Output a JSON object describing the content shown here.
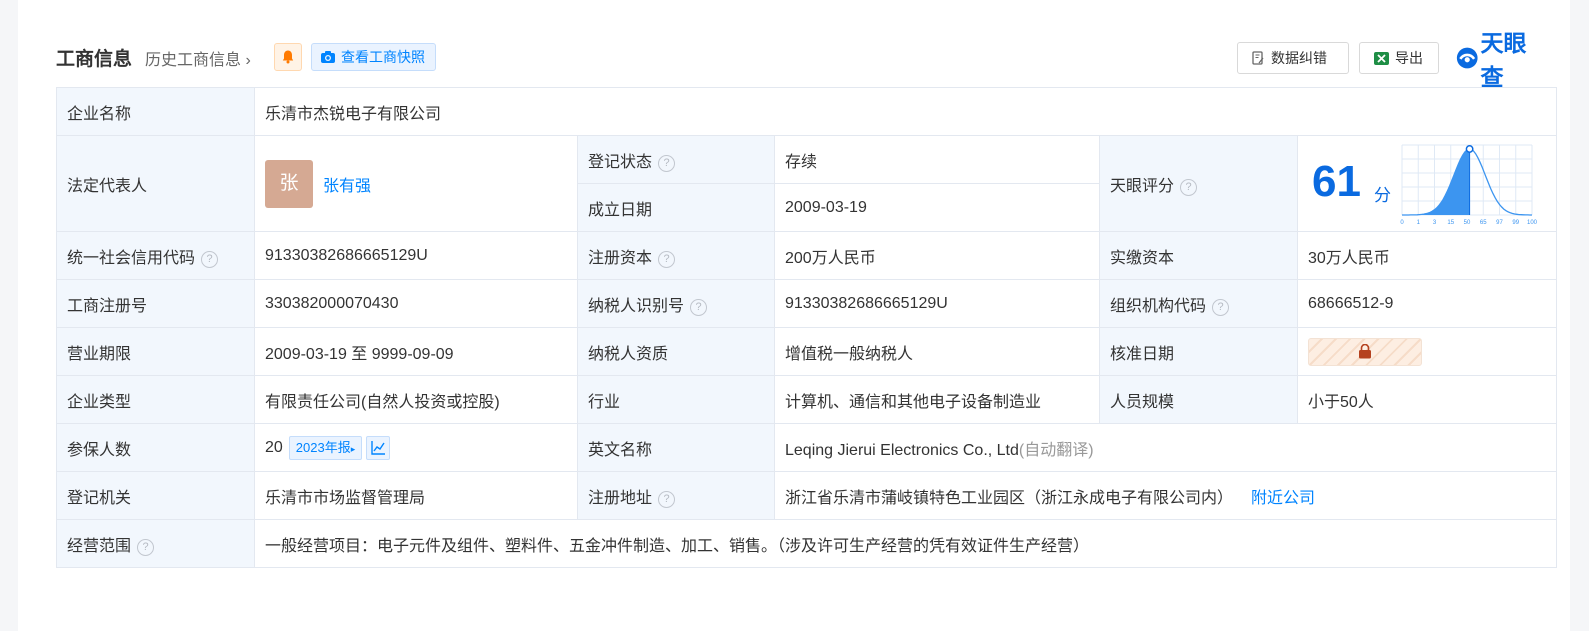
{
  "header": {
    "title": "工商信息",
    "history_link": "历史工商信息",
    "snapshot_button": "查看工商快照",
    "correction_button": "数据纠错",
    "export_button": "导出",
    "logo_text": "天眼查"
  },
  "company": {
    "name_label": "企业名称",
    "name": "乐清市杰锐电子有限公司",
    "legal_rep_label": "法定代表人",
    "legal_rep_avatar": "张",
    "legal_rep_name": "张有强",
    "status_label": "登记状态",
    "status": "存续",
    "founded_label": "成立日期",
    "founded": "2009-03-19",
    "score_label": "天眼评分",
    "score": "61",
    "score_unit": "分",
    "score_axis_ticks": [
      "0",
      "1",
      "3",
      "15",
      "50",
      "65",
      "97",
      "99",
      "100"
    ],
    "credit_code_label": "统一社会信用代码",
    "credit_code": "91330382686665129U",
    "reg_capital_label": "注册资本",
    "reg_capital": "200万人民币",
    "paid_capital_label": "实缴资本",
    "paid_capital": "30万人民币",
    "reg_no_label": "工商注册号",
    "reg_no": "330382000070430",
    "taxpayer_id_label": "纳税人识别号",
    "taxpayer_id": "91330382686665129U",
    "org_code_label": "组织机构代码",
    "org_code": "68666512-9",
    "term_label": "营业期限",
    "term": "2009-03-19 至 9999-09-09",
    "taxpayer_type_label": "纳税人资质",
    "taxpayer_type": "增值税一般纳税人",
    "approval_date_label": "核准日期",
    "company_type_label": "企业类型",
    "company_type": "有限责任公司(自然人投资或控股)",
    "industry_label": "行业",
    "industry": "计算机、通信和其他电子设备制造业",
    "staff_size_label": "人员规模",
    "staff_size": "小于50人",
    "insured_label": "参保人数",
    "insured": "20",
    "annual_report_badge": "2023年报",
    "english_name_label": "英文名称",
    "english_name": "Leqing Jierui Electronics Co., Ltd",
    "auto_translate": "(自动翻译)",
    "authority_label": "登记机关",
    "authority": "乐清市市场监督管理局",
    "address_label": "注册地址",
    "address": "浙江省乐清市蒲岐镇特色工业园区（浙江永成电子有限公司内）",
    "nearby_link": "附近公司",
    "scope_label": "经营范围",
    "scope": "一般经营项目：电子元件及组件、塑料件、五金冲件制造、加工、销售。（涉及许可生产经营的凭有效证件生产经营）"
  },
  "colors": {
    "accent": "#0084ff",
    "brand": "#0a6ae0",
    "status_green": "#19a55c",
    "label_bg": "#f2f7fd"
  }
}
